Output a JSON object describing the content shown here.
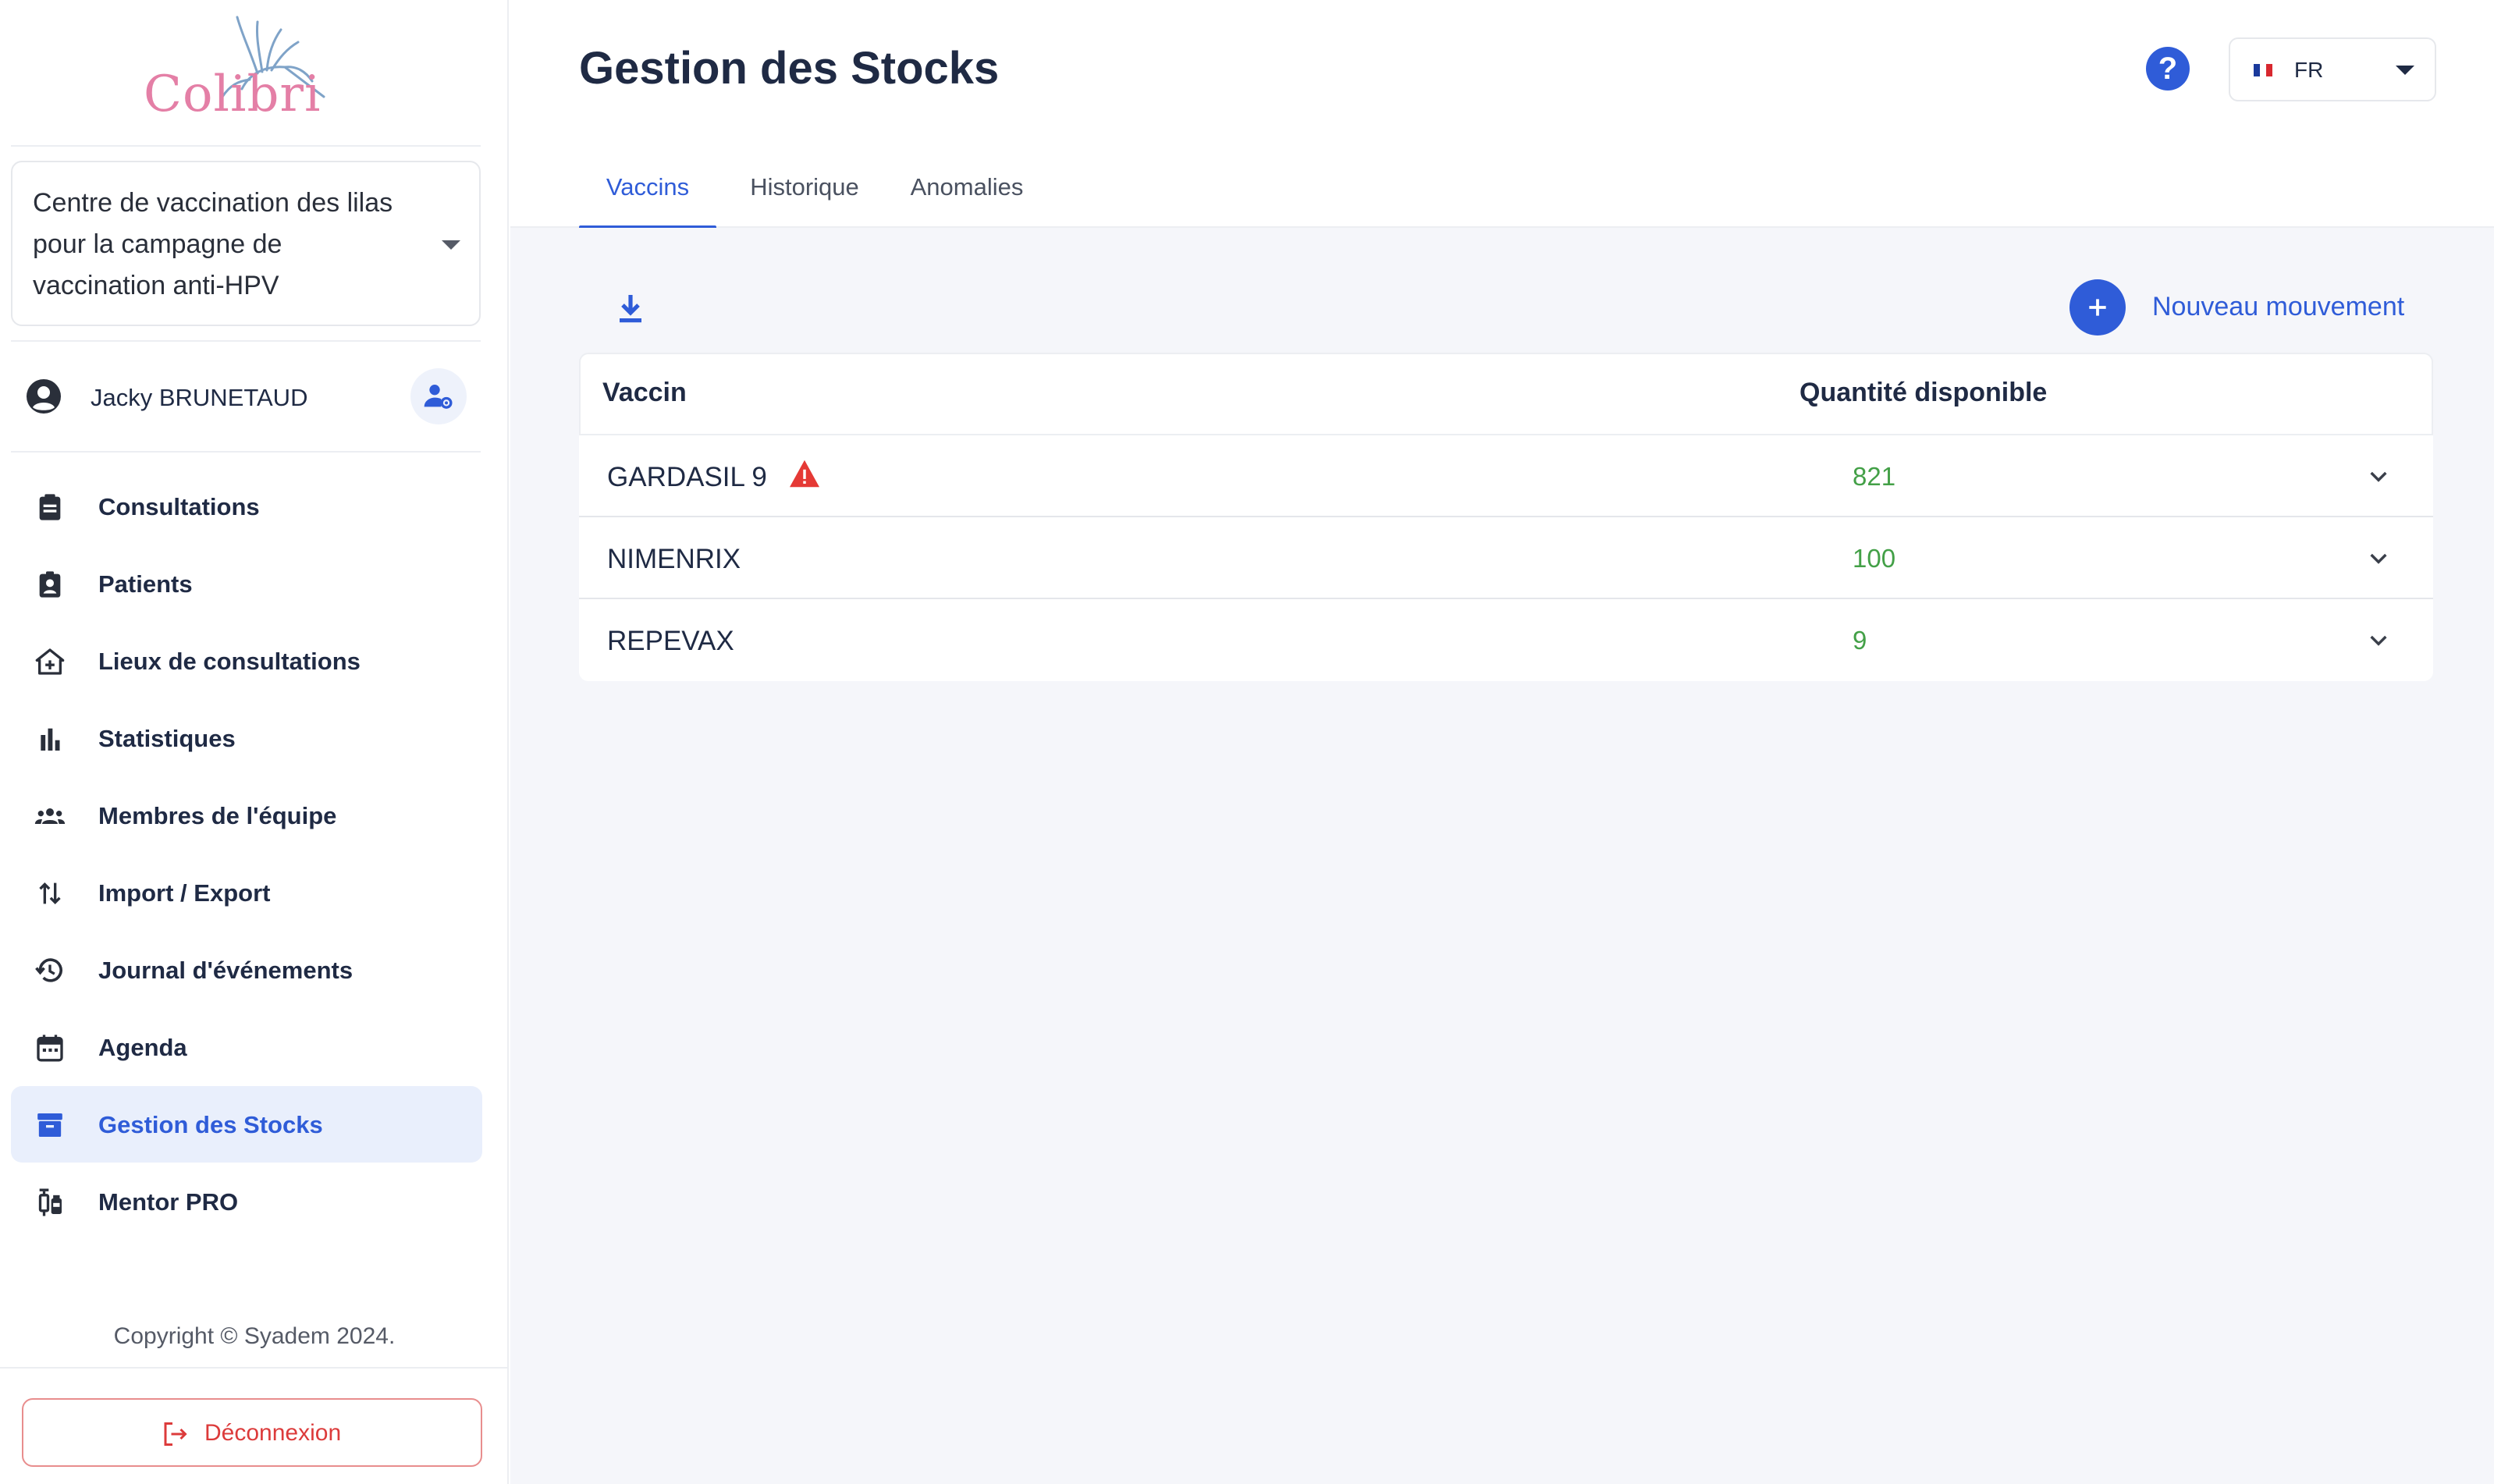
{
  "sidebar": {
    "logo_text": "Colibri",
    "center_select_value": "Centre de vaccination des lilas pour la campagne de vaccination anti-HPV",
    "user_name": "Jacky BRUNETAUD",
    "nav": [
      {
        "label": "Consultations",
        "icon": "clipboard-icon"
      },
      {
        "label": "Patients",
        "icon": "patient-badge-icon"
      },
      {
        "label": "Lieux de consultations",
        "icon": "medical-home-icon"
      },
      {
        "label": "Statistiques",
        "icon": "bar-chart-icon"
      },
      {
        "label": "Membres de l'équipe",
        "icon": "team-icon"
      },
      {
        "label": "Import / Export",
        "icon": "import-export-icon"
      },
      {
        "label": "Journal d'événements",
        "icon": "history-icon"
      },
      {
        "label": "Agenda",
        "icon": "calendar-icon"
      },
      {
        "label": "Gestion des Stocks",
        "icon": "archive-icon",
        "active": true
      },
      {
        "label": "Mentor PRO",
        "icon": "syringe-icon"
      }
    ],
    "copyright": "Copyright © Syadem 2024.",
    "logout_label": "Déconnexion"
  },
  "header": {
    "title": "Gestion des Stocks",
    "help_label": "?",
    "language": "FR",
    "tabs": [
      {
        "label": "Vaccins",
        "active": true
      },
      {
        "label": "Historique"
      },
      {
        "label": "Anomalies"
      }
    ]
  },
  "toolbar": {
    "new_movement_label": "Nouveau mouvement"
  },
  "table": {
    "columns": [
      "Vaccin",
      "Quantité disponible"
    ],
    "rows": [
      {
        "vaccine": "GARDASIL 9",
        "quantity": "821",
        "warning": true
      },
      {
        "vaccine": "NIMENRIX",
        "quantity": "100",
        "warning": false
      },
      {
        "vaccine": "REPEVAX",
        "quantity": "9",
        "warning": false
      }
    ]
  },
  "colors": {
    "accent": "#2f5cd8",
    "quantity_green": "#43a047",
    "danger": "#dc3b3b"
  }
}
